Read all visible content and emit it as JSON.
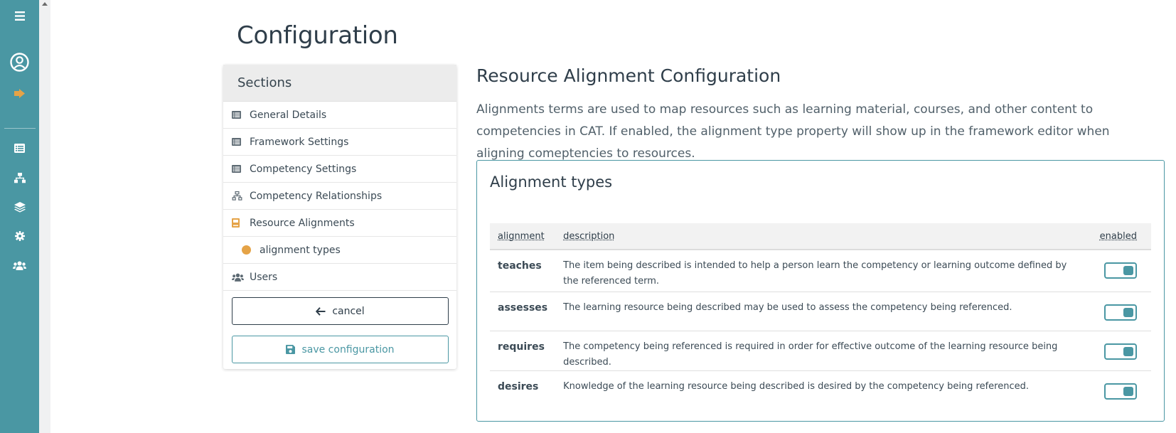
{
  "rail": {
    "icons": [
      "menu-icon",
      "user-circle-icon",
      "sign-out-icon",
      "list-icon",
      "sitemap-icon",
      "layers-icon",
      "gear-icon",
      "users-icon"
    ]
  },
  "page": {
    "title": "Configuration"
  },
  "sections": {
    "header": "Sections",
    "items": [
      {
        "label": "General Details",
        "icon": "list-icon"
      },
      {
        "label": "Framework Settings",
        "icon": "list-icon"
      },
      {
        "label": "Competency Settings",
        "icon": "list-icon"
      },
      {
        "label": "Competency Relationships",
        "icon": "sitemap-icon"
      },
      {
        "label": "Resource Alignments",
        "icon": "book-icon",
        "active": true
      },
      {
        "label": "alignment types",
        "icon": "dot-icon",
        "sub": true
      },
      {
        "label": "Users",
        "icon": "users-icon"
      }
    ],
    "cancel_label": "cancel",
    "save_label": "save configuration"
  },
  "main": {
    "title": "Resource Alignment Configuration",
    "description": "Alignments terms are used to map resources such as learning material, courses, and other content to competencies in CAT. If enabled, the alignment type property will show up in the framework editor when aligning comeptencies to resources.",
    "card": {
      "title": "Alignment types",
      "columns": {
        "alignment": "alignment",
        "description": "description",
        "enabled": "enabled"
      },
      "rows": [
        {
          "alignment": "teaches",
          "description": "The item being described is intended to help a person learn the competency or learning outcome defined by the referenced term.",
          "enabled": true
        },
        {
          "alignment": "assesses",
          "description": "The learning resource being described may be used to assess the competency being referenced.",
          "enabled": true
        },
        {
          "alignment": "requires",
          "description": "The competency being referenced is required in order for effective outcome of the learning resource being described.",
          "enabled": true
        },
        {
          "alignment": "desires",
          "description": "Knowledge of the learning resource being described is desired by the competency being referenced.",
          "enabled": true
        }
      ]
    }
  },
  "colors": {
    "accent": "#4a97a3",
    "orange": "#e5a347",
    "text": "#2f3e4a"
  }
}
